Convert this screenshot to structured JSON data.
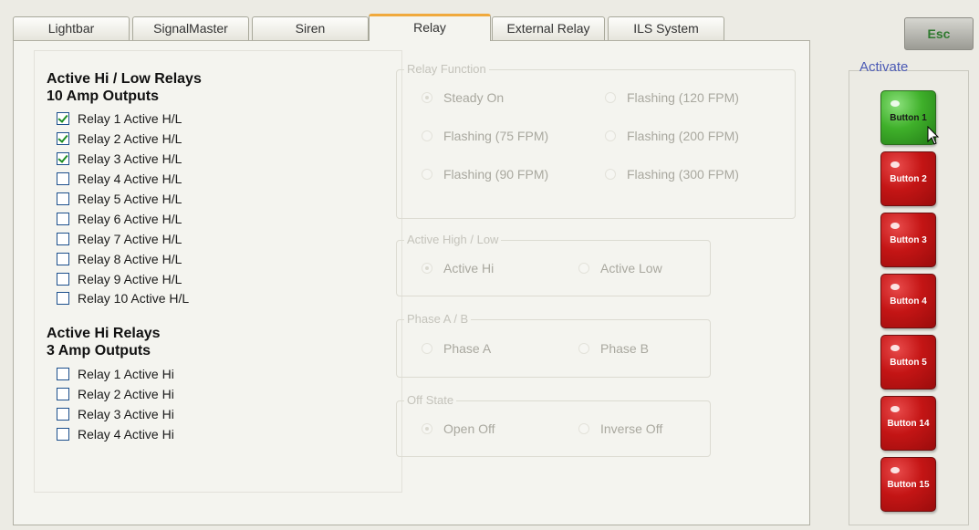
{
  "tabs": [
    "Lightbar",
    "SignalMaster",
    "Siren",
    "Relay",
    "External Relay",
    "ILS System"
  ],
  "active_tab": "Relay",
  "esc_label": "Esc",
  "activate_label": "Activate",
  "left": {
    "hilo_title_1": "Active Hi / Low Relays",
    "hilo_title_2": "10 Amp Outputs",
    "hilo_relays": [
      {
        "label": "Relay 1 Active H/L",
        "checked": true
      },
      {
        "label": "Relay 2 Active H/L",
        "checked": true
      },
      {
        "label": "Relay 3 Active H/L",
        "checked": true
      },
      {
        "label": "Relay 4 Active H/L",
        "checked": false
      },
      {
        "label": "Relay 5 Active H/L",
        "checked": false
      },
      {
        "label": "Relay 6 Active H/L",
        "checked": false
      },
      {
        "label": "Relay 7 Active H/L",
        "checked": false
      },
      {
        "label": "Relay 8 Active H/L",
        "checked": false
      },
      {
        "label": "Relay 9 Active H/L",
        "checked": false
      },
      {
        "label": "Relay 10 Active H/L",
        "checked": false
      }
    ],
    "hi_title_1": "Active Hi Relays",
    "hi_title_2": "3 Amp Outputs",
    "hi_relays": [
      {
        "label": "Relay 1 Active Hi",
        "checked": false
      },
      {
        "label": "Relay 2 Active Hi",
        "checked": false
      },
      {
        "label": "Relay 3 Active Hi",
        "checked": false
      },
      {
        "label": "Relay 4 Active Hi",
        "checked": false
      }
    ]
  },
  "relay_function": {
    "legend": "Relay Function",
    "options": [
      "Steady On",
      "Flashing (120 FPM)",
      "Flashing (75 FPM)",
      "Flashing (200 FPM)",
      "Flashing (90 FPM)",
      "Flashing (300 FPM)"
    ],
    "selected": "Steady On"
  },
  "active_high_low": {
    "legend": "Active High / Low",
    "options": [
      "Active Hi",
      "Active Low"
    ],
    "selected": "Active Hi"
  },
  "phase": {
    "legend": "Phase A / B",
    "options": [
      "Phase A",
      "Phase B"
    ],
    "selected": ""
  },
  "off_state": {
    "legend": "Off State",
    "options": [
      "Open Off",
      "Inverse Off"
    ],
    "selected": "Open Off"
  },
  "buttons": [
    {
      "label": "Button 1",
      "color": "#3fb02a",
      "active": true
    },
    {
      "label": "Button 2",
      "color": "#c41515",
      "active": false
    },
    {
      "label": "Button 3",
      "color": "#c41515",
      "active": false
    },
    {
      "label": "Button 4",
      "color": "#c41515",
      "active": false
    },
    {
      "label": "Button 5",
      "color": "#c41515",
      "active": false
    },
    {
      "label": "Button 14",
      "color": "#c41515",
      "active": false
    },
    {
      "label": "Button 15",
      "color": "#c41515",
      "active": false
    }
  ]
}
